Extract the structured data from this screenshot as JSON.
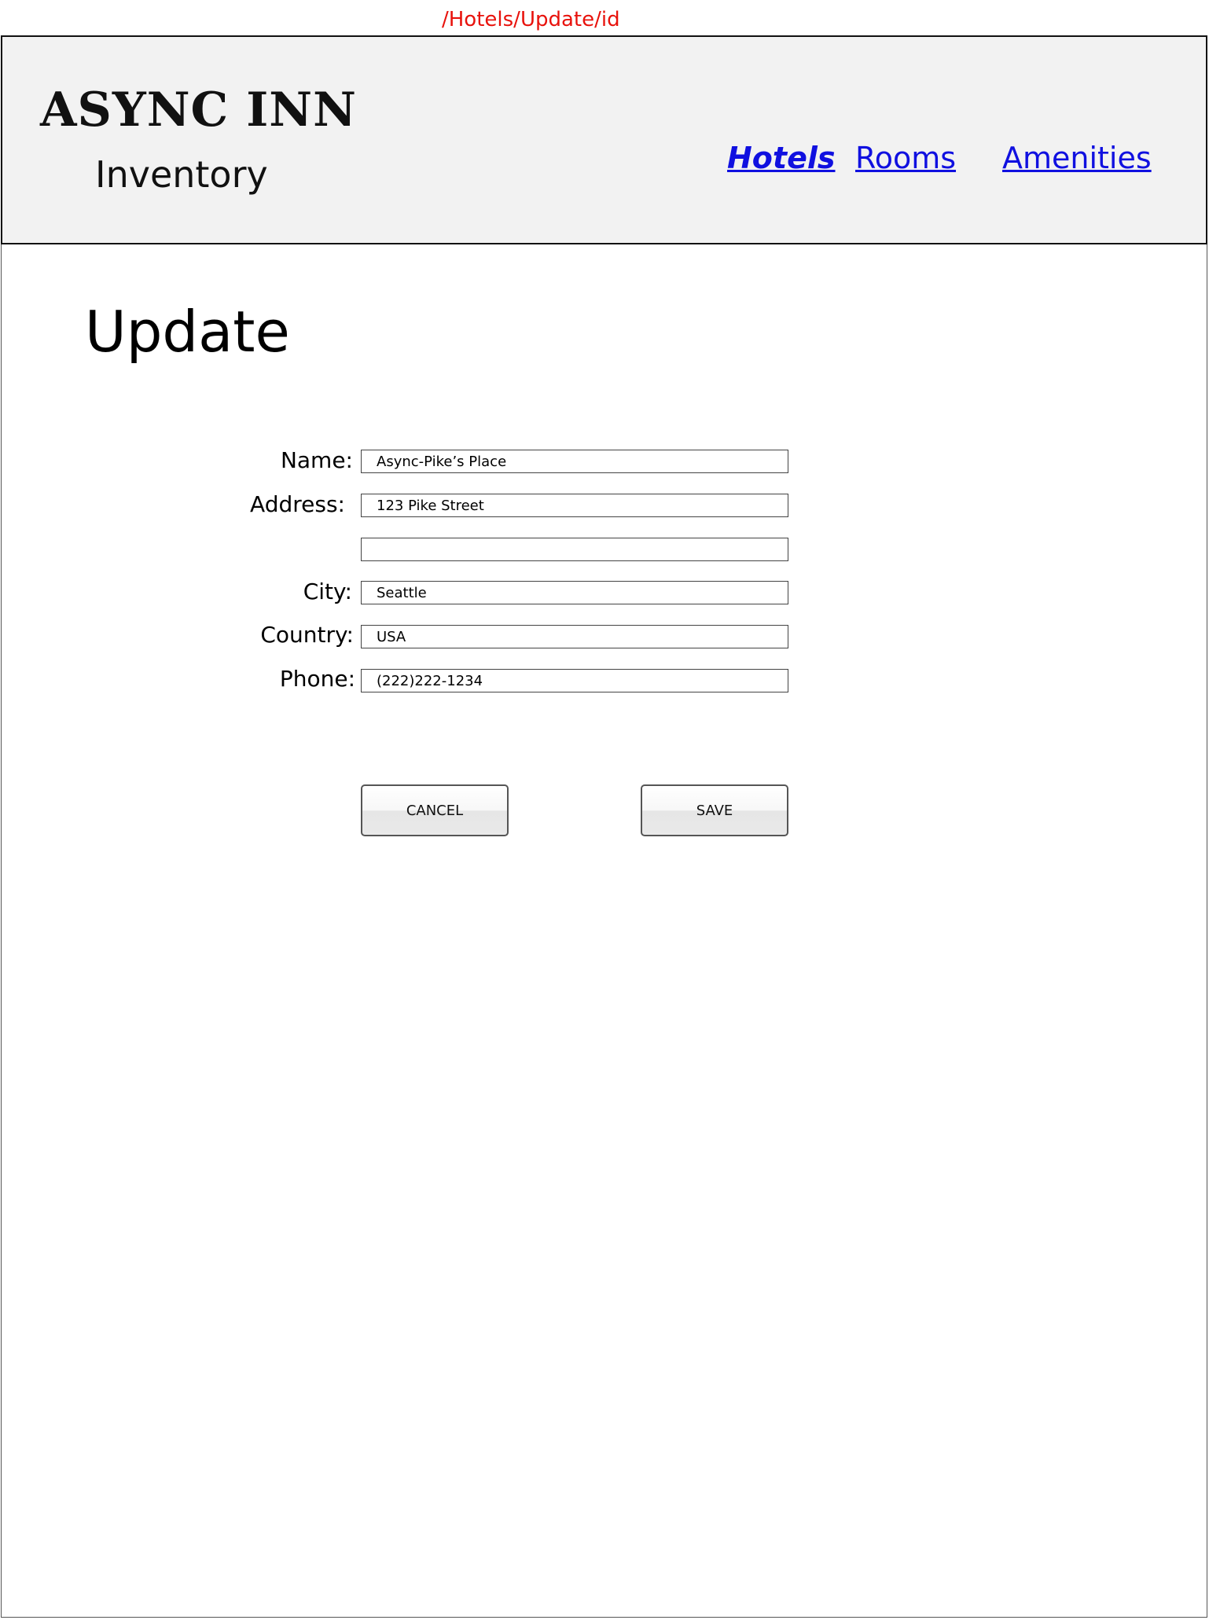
{
  "route": "/Hotels/Update/id",
  "header": {
    "brand_title": "ASYNC INN",
    "brand_subtitle": "Inventory",
    "nav": [
      {
        "label": "Hotels",
        "active": true
      },
      {
        "label": "Rooms",
        "active": false
      },
      {
        "label": "Amenities",
        "active": false
      }
    ]
  },
  "main": {
    "title": "Update",
    "form": {
      "name_label": "Name:",
      "name_value": "Async-Pike’s Place",
      "address_label": "Address:",
      "address_line1_value": "123 Pike Street",
      "address_line2_value": "",
      "city_label": "City:",
      "city_value": "Seattle",
      "country_label": "Country:",
      "country_value": "USA",
      "phone_label": "Phone:",
      "phone_value": "(222)222-1234"
    },
    "actions": {
      "cancel_label": "CANCEL",
      "save_label": "SAVE"
    }
  },
  "colors": {
    "route_label": "#e8120c",
    "header_background": "#f2f2f2",
    "link": "#1010e0"
  }
}
